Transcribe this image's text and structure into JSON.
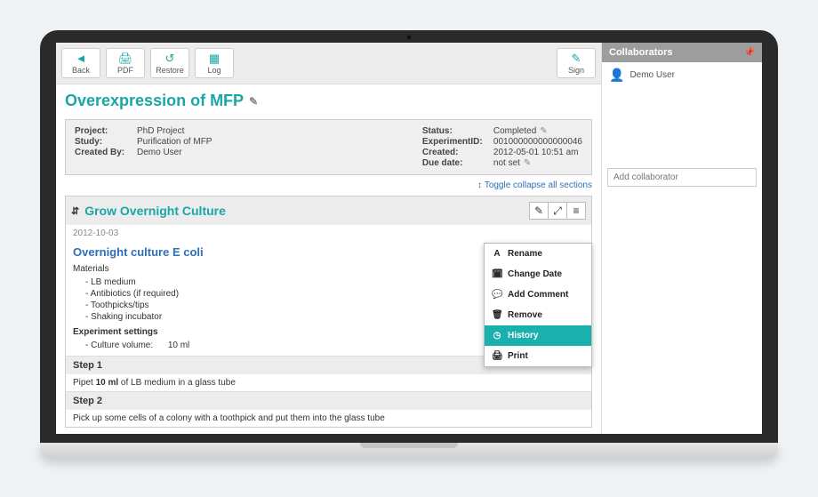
{
  "toolbar": {
    "back": "Back",
    "pdf": "PDF",
    "restore": "Restore",
    "log": "Log",
    "sign": "Sign"
  },
  "page_title": "Overexpression of MFP",
  "meta_left": {
    "project_key": "Project:",
    "project_val": "PhD Project",
    "study_key": "Study:",
    "study_val": "Purification of MFP",
    "created_by_key": "Created By:",
    "created_by_val": "Demo User"
  },
  "meta_right": {
    "status_key": "Status:",
    "status_val": "Completed",
    "expid_key": "ExperimentID:",
    "expid_val": "001000000000000046",
    "created_key": "Created:",
    "created_val": "2012-05-01 10:51 am",
    "due_key": "Due date:",
    "due_val": "not set"
  },
  "toggle_all": "Toggle collapse all sections",
  "section": {
    "title": "Grow Overnight Culture",
    "date": "2012-10-03",
    "sub_title": "Overnight culture E coli",
    "materials_label": "Materials",
    "materials": [
      "LB medium",
      "Antibiotics (if required)",
      "Toothpicks/tips",
      "Shaking incubator"
    ],
    "exp_settings_label": "Experiment settings",
    "setting_key": "Culture volume:",
    "setting_val": "10 ml",
    "step1_h": "Step 1",
    "step1_b_pre": "Pipet ",
    "step1_b_bold": "10 ml",
    "step1_b_post": " of LB medium in a glass tube",
    "step2_h": "Step 2",
    "step2_b": "Pick up some cells of a colony with a toothpick and put them into the glass tube"
  },
  "menu": {
    "rename": "Rename",
    "change_date": "Change Date",
    "add_comment": "Add Comment",
    "remove": "Remove",
    "history": "History",
    "print": "Print"
  },
  "sidebar": {
    "collab_header": "Collaborators",
    "collab_user": "Demo User",
    "add_placeholder": "Add collaborator"
  }
}
